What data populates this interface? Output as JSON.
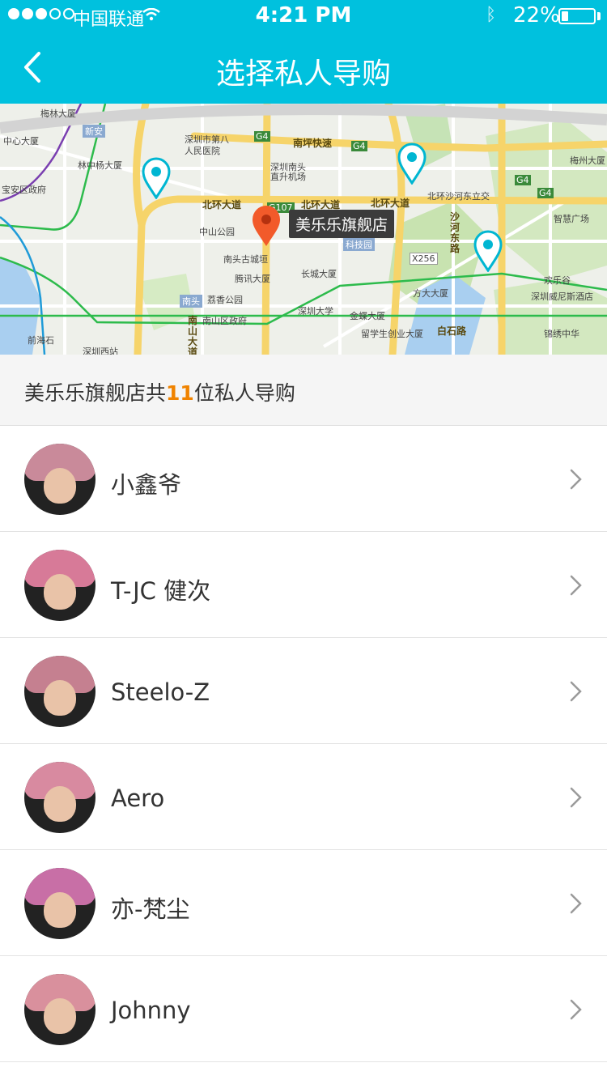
{
  "status_bar": {
    "carrier": "中国联通",
    "time": "4:21 PM",
    "battery_percent_text": "22%",
    "battery_level": 0.22,
    "signal_bars_on": 3,
    "signal_bars_total": 5
  },
  "nav": {
    "title": "选择私人导购",
    "back_icon": "chevron-left-icon",
    "bg_color": "#00c1de"
  },
  "map": {
    "selected_store_callout": "美乐乐旗舰店",
    "labels": {
      "l1": "中心大厦",
      "l2": "林中杨大厦",
      "l3": "新安",
      "l4": "深圳市第八",
      "l5": "人民医院",
      "l6": "深圳南头",
      "l7": "直升机场",
      "l8": "南坪快速",
      "l9": "宝安区政府",
      "l10": "北环大道",
      "l11": "北环大道",
      "l12": "北环大道",
      "l13": "北环沙河东立交",
      "l14": "中山公园",
      "l15": "南头古城垣",
      "l16": "腾讯大厦",
      "l17": "长城大厦",
      "l18": "科技园",
      "l19": "南头",
      "l20": "荔香公园",
      "l21": "南山区政府",
      "l22": "深圳大学",
      "l23": "金蝶大厦",
      "l24": "留学生创业大厦",
      "l25": "方大大厦",
      "l26": "白石路",
      "l27": "沙河东路",
      "l28": "欢乐谷",
      "l29": "深圳威尼斯酒店",
      "l30": "锦绣中华",
      "l31": "智慧广场",
      "l32": "梅州大厦",
      "l33": "前海石",
      "l34": "深圳西站",
      "l35": "南山大道",
      "l36": "X256",
      "l37": "G107",
      "l38": "G4",
      "l39": "G4",
      "l40": "G4",
      "l41": "G4",
      "l42": "梅林大厦"
    }
  },
  "count_header": {
    "prefix": "美乐乐旗舰店共",
    "number": "11",
    "suffix": "位私人导购",
    "number_color": "#f08300"
  },
  "guides": [
    {
      "name": "小鑫爷",
      "hair_color": "#c98a9a"
    },
    {
      "name": "T-JC 健次",
      "hair_color": "#d77a98"
    },
    {
      "name": "Steelo-Z",
      "hair_color": "#c58090"
    },
    {
      "name": "Aero",
      "hair_color": "#d88aa0"
    },
    {
      "name": "亦-梵尘",
      "hair_color": "#c86fa6"
    },
    {
      "name": "Johnny",
      "hair_color": "#d9909d"
    }
  ],
  "row_chevron_icon": "chevron-right-icon"
}
